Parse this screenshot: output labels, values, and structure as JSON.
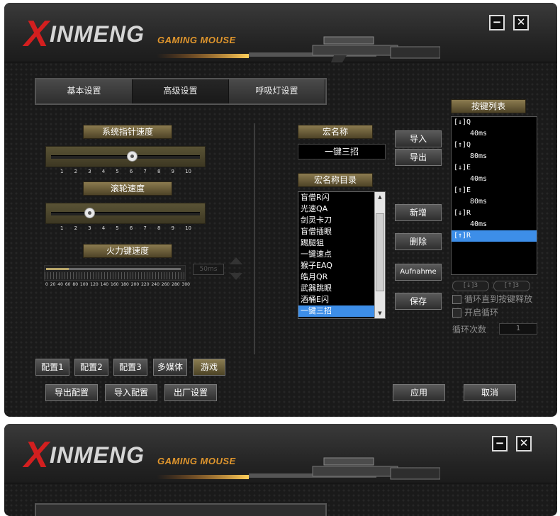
{
  "brand": {
    "logo_x": "X",
    "logo_word": "INMENG",
    "tagline": "GAMING MOUSE"
  },
  "window": {
    "minimize": "−",
    "close": "✕"
  },
  "tabs": [
    {
      "label": "基本设置",
      "active": false
    },
    {
      "label": "高级设置",
      "active": true
    },
    {
      "label": "呼吸灯设置",
      "active": false
    }
  ],
  "pointer_speed": {
    "label": "系统指针速度",
    "ticks": [
      "1",
      "2",
      "3",
      "4",
      "5",
      "6",
      "7",
      "8",
      "9",
      "10"
    ],
    "value": 6
  },
  "scroll_speed": {
    "label": "滚轮速度",
    "ticks": [
      "1",
      "2",
      "3",
      "4",
      "5",
      "6",
      "7",
      "8",
      "9",
      "10"
    ],
    "value": 3
  },
  "fire_speed": {
    "label": "火力键速度",
    "ticks": [
      "0",
      "20",
      "40",
      "60",
      "80",
      "100",
      "120",
      "140",
      "160",
      "180",
      "200",
      "220",
      "240",
      "260",
      "280",
      "300"
    ],
    "value_text": "50ms"
  },
  "configs": [
    {
      "label": "配置1",
      "selected": false
    },
    {
      "label": "配置2",
      "selected": false
    },
    {
      "label": "配置3",
      "selected": false
    },
    {
      "label": "多媒体",
      "selected": false
    },
    {
      "label": "游戏",
      "selected": true
    }
  ],
  "config_actions": {
    "export": "导出配置",
    "import": "导入配置",
    "factory": "出厂设置"
  },
  "macro": {
    "name_label": "宏名称",
    "name_value": "一键三招",
    "dir_label": "宏名称目录",
    "import": "导入",
    "export": "导出",
    "add": "新增",
    "delete": "删除",
    "record": "Aufnahme",
    "save": "保存",
    "items": [
      {
        "text": "盲僧R闪",
        "selected": false
      },
      {
        "text": "光速QA",
        "selected": false
      },
      {
        "text": "剑灵卡刀",
        "selected": false
      },
      {
        "text": "盲僧插眼",
        "selected": false
      },
      {
        "text": "踢腿狙",
        "selected": false
      },
      {
        "text": "一键速点",
        "selected": false
      },
      {
        "text": "猴子EAQ",
        "selected": false
      },
      {
        "text": "皓月QR",
        "selected": false
      },
      {
        "text": "武器跳眼",
        "selected": false
      },
      {
        "text": "酒桶E闪",
        "selected": false
      },
      {
        "text": "一键三招",
        "selected": true
      }
    ]
  },
  "key_list": {
    "label": "按键列表",
    "rows": [
      {
        "text": "[↓]Q",
        "type": "key",
        "selected": false
      },
      {
        "text": "40ms",
        "type": "delay",
        "selected": false
      },
      {
        "text": "[↑]Q",
        "type": "key",
        "selected": false
      },
      {
        "text": "80ms",
        "type": "delay",
        "selected": false
      },
      {
        "text": "[↓]E",
        "type": "key",
        "selected": false
      },
      {
        "text": "40ms",
        "type": "delay",
        "selected": false
      },
      {
        "text": "[↑]E",
        "type": "key",
        "selected": false
      },
      {
        "text": "80ms",
        "type": "delay",
        "selected": false
      },
      {
        "text": "[↓]R",
        "type": "key",
        "selected": false
      },
      {
        "text": "40ms",
        "type": "delay",
        "selected": false
      },
      {
        "text": "[↑]R",
        "type": "key",
        "selected": true
      }
    ],
    "down_btn": "[↓]3",
    "up_btn": "[↑]3",
    "loop_until_key": "循环直到按键释放",
    "start_loop": "开启循环",
    "loop_count_label": "循环次数",
    "loop_count_value": "1"
  },
  "footer": {
    "apply": "应用",
    "cancel": "取消"
  }
}
